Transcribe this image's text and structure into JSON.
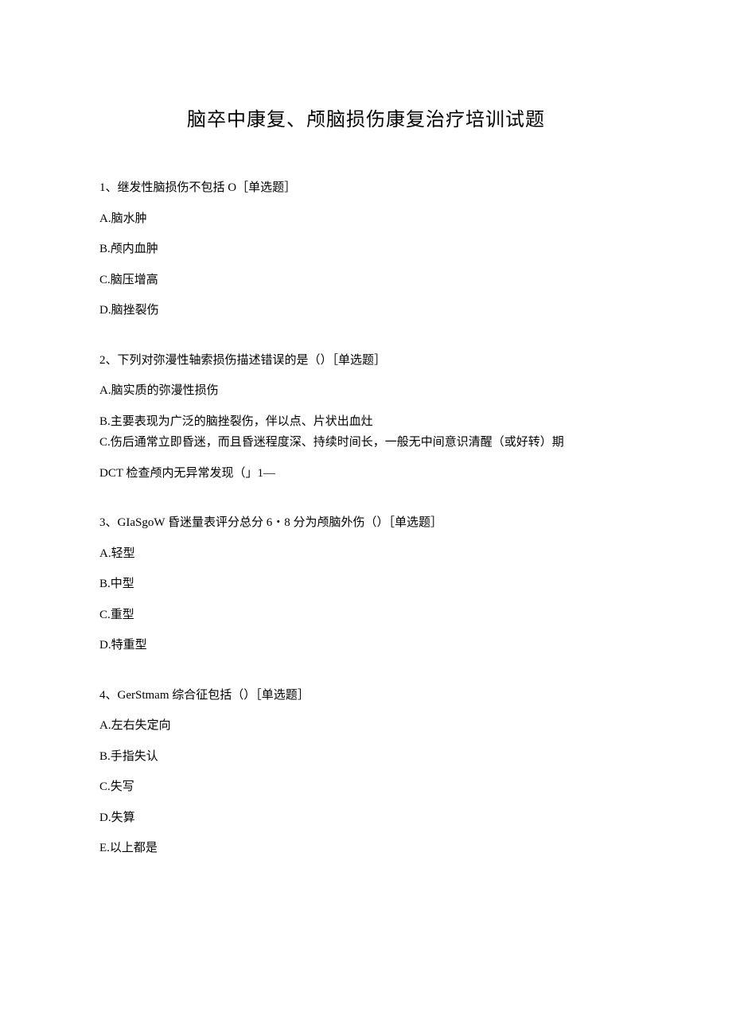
{
  "title": "脑卒中康复、颅脑损伤康复治疗培训试题",
  "questions": [
    {
      "stem": "1、继发性脑损伤不包括 O［单选题］",
      "options": [
        "A.脑水肿",
        "B.颅内血肿",
        "C.脑压增高",
        "D.脑挫裂伤"
      ]
    },
    {
      "stem": "2、下列对弥漫性轴索损伤描述错误的是（）［单选题］",
      "options": [
        "A.脑实质的弥漫性损伤",
        "B.主要表现为广泛的脑挫裂伤，伴以点、片状出血灶",
        "C.伤后通常立即昏迷，而且昏迷程度深、持续时间长，一般无中间意识清醒（或好转）期",
        "DCT 检查颅内无异常发现（」1—"
      ]
    },
    {
      "stem": "3、GIaSgoW 昏迷量表评分总分 6・8 分为颅脑外伤（）［单选题］",
      "options": [
        "A.轻型",
        "B.中型",
        "C.重型",
        "D.特重型"
      ]
    },
    {
      "stem": "4、GerStmam 综合征包括（）［单选题］",
      "options": [
        "A.左右失定向",
        "B.手指失认",
        "C.失写",
        "D.失算",
        "E.以上都是"
      ]
    }
  ]
}
